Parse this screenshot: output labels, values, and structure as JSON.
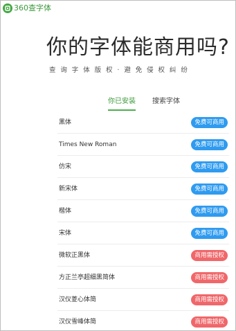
{
  "app": {
    "logo_text": "360查字体"
  },
  "hero": {
    "title": "你的字体能商用吗?",
    "subtitle": "查询字体版权·避免侵权纠纷"
  },
  "tabs": [
    {
      "label": "你已安装",
      "active": true
    },
    {
      "label": "搜索字体",
      "active": false
    }
  ],
  "colors": {
    "brand_green": "#45a845",
    "free_badge": "#2f9bf0",
    "license_badge": "#f0676a"
  },
  "fonts": [
    {
      "name": "黑体",
      "status": "免费可商用",
      "kind": "free"
    },
    {
      "name": "Times New Roman",
      "status": "免费可商用",
      "kind": "free"
    },
    {
      "name": "仿宋",
      "status": "免费可商用",
      "kind": "free"
    },
    {
      "name": "新宋体",
      "status": "免费可商用",
      "kind": "free"
    },
    {
      "name": "楷体",
      "status": "免费可商用",
      "kind": "free"
    },
    {
      "name": "宋体",
      "status": "免费可商用",
      "kind": "free"
    },
    {
      "name": "微软正黑体",
      "status": "商用需授权",
      "kind": "license"
    },
    {
      "name": "方正兰亭超细黑简体",
      "status": "商用需授权",
      "kind": "license"
    },
    {
      "name": "汉仪菱心体简",
      "status": "商用需授权",
      "kind": "license"
    },
    {
      "name": "汉仪雪峰体简",
      "status": "商用需授权",
      "kind": "license"
    }
  ]
}
